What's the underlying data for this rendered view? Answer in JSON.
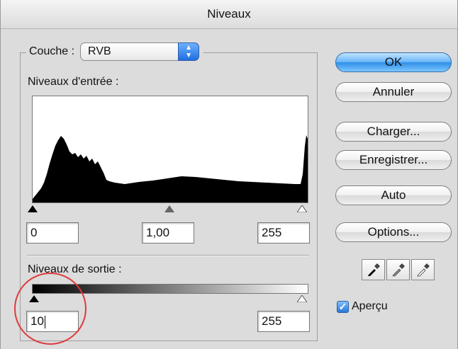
{
  "window": {
    "title": "Niveaux"
  },
  "channel": {
    "label": "Couche :",
    "selected": "RVB"
  },
  "input_levels": {
    "label": "Niveaux d'entrée :",
    "black": "0",
    "gamma": "1,00",
    "white": "255"
  },
  "output_levels": {
    "label": "Niveaux de sortie :",
    "black": "10",
    "white": "255"
  },
  "buttons": {
    "ok": "OK",
    "cancel": "Annuler",
    "load": "Charger...",
    "save": "Enregistrer...",
    "auto": "Auto",
    "options": "Options..."
  },
  "eyedroppers": [
    "black-point-eyedropper-icon",
    "gray-point-eyedropper-icon",
    "white-point-eyedropper-icon"
  ],
  "preview": {
    "label": "Aperçu",
    "checked": true
  },
  "colors": {
    "accent": "#2f8fe8",
    "highlight_circle": "#e03a3a"
  }
}
